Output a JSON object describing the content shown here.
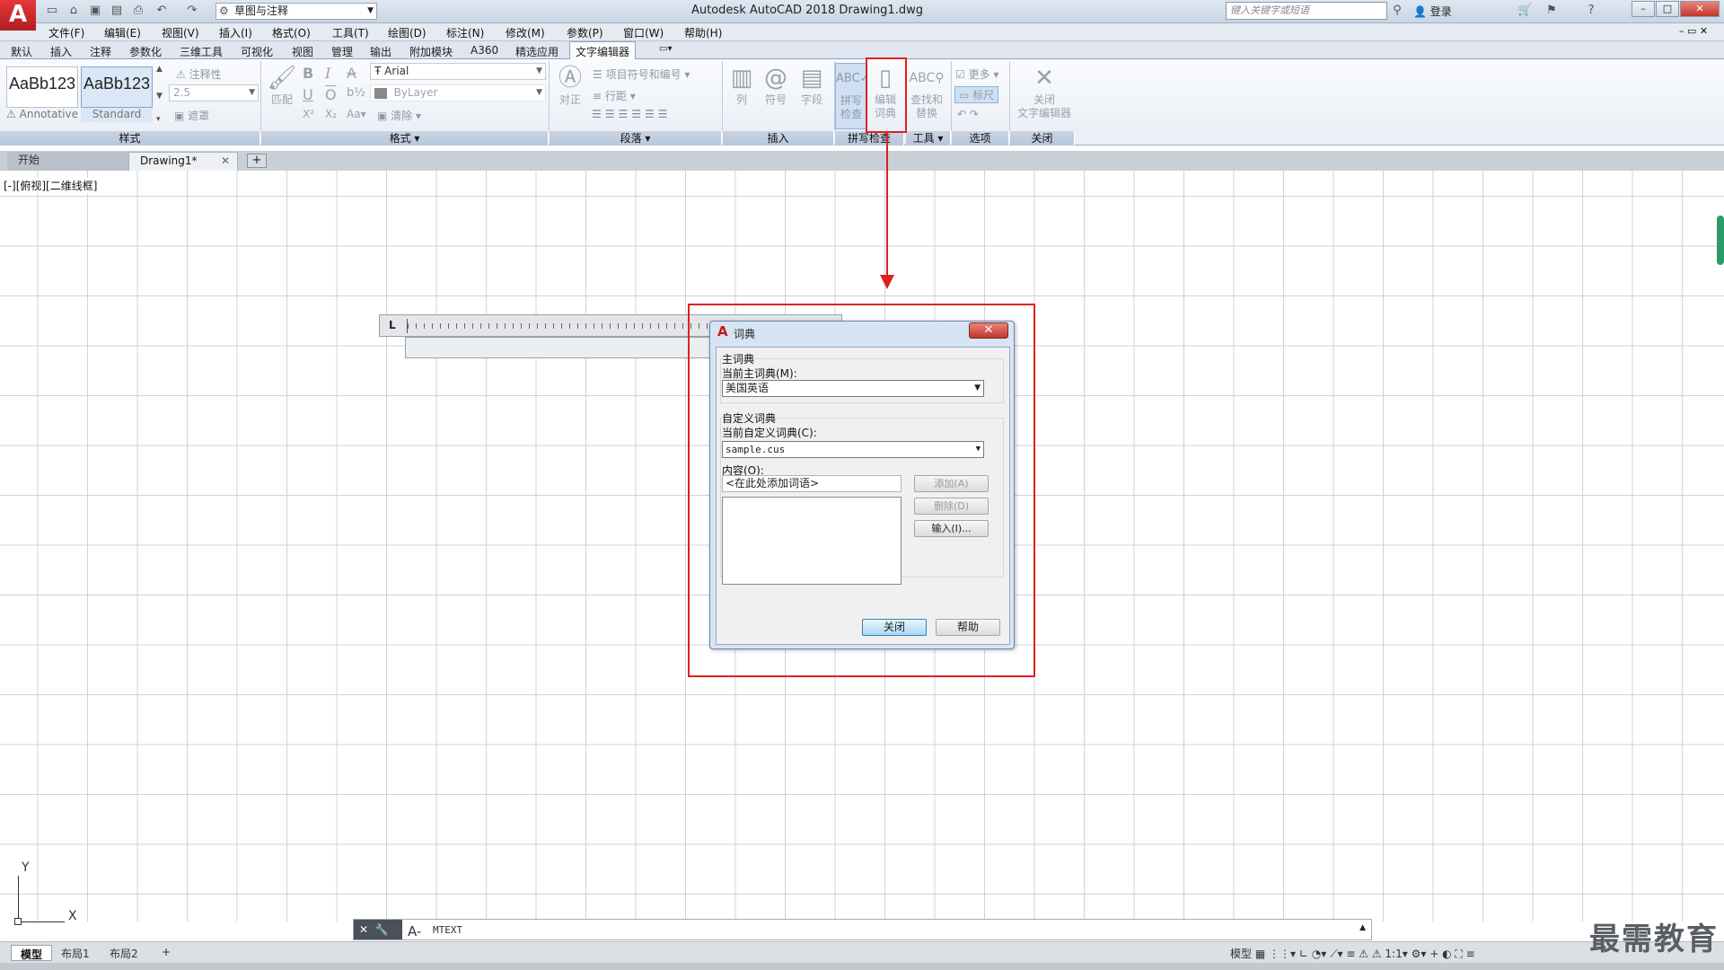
{
  "window": {
    "title": "Autodesk AutoCAD 2018    Drawing1.dwg",
    "workspace": "草图与注释",
    "search_placeholder": "键入关键字或短语",
    "login": "登录",
    "app_logo_letter": "A"
  },
  "menu": [
    "文件(F)",
    "编辑(E)",
    "视图(V)",
    "插入(I)",
    "格式(O)",
    "工具(T)",
    "绘图(D)",
    "标注(N)",
    "修改(M)",
    "参数(P)",
    "窗口(W)",
    "帮助(H)"
  ],
  "ribbon_tabs": [
    "默认",
    "插入",
    "注释",
    "参数化",
    "三维工具",
    "可视化",
    "视图",
    "管理",
    "输出",
    "附加模块",
    "A360",
    "精选应用",
    "文字编辑器"
  ],
  "ribbon_active_tab": "文字编辑器",
  "ribbon": {
    "style": {
      "swatch1": "AaBb123",
      "swatch1_caption": "Annotative",
      "swatch2": "AaBb123",
      "swatch2_caption": "Standard",
      "annotative_label": "注释性",
      "text_height": "2.5",
      "mask_label": "遮罩",
      "panel_title": "样式"
    },
    "format": {
      "match_label": "匹配",
      "font": "Arial",
      "color": "ByLayer",
      "clear_label": "清除",
      "panel_title": "格式"
    },
    "paragraph": {
      "justify_label": "对正",
      "bullets_label": "项目符号和编号",
      "line_spacing_label": "行距",
      "panel_title": "段落"
    },
    "insert": {
      "columns_label": "列",
      "symbol_label": "符号",
      "field_label": "字段",
      "panel_title": "插入"
    },
    "spellcheck": {
      "spell_label_1": "拼写",
      "spell_label_2": "检查",
      "edit_dict_1": "编辑",
      "edit_dict_2": "词典",
      "panel_title": "拼写检查"
    },
    "tools": {
      "find_1": "查找和",
      "find_2": "替换",
      "panel_title": "工具"
    },
    "options": {
      "more_label": "更多",
      "ruler_label": "标尺",
      "panel_title": "选项"
    },
    "close": {
      "close_1": "关闭",
      "close_2": "文字编辑器",
      "panel_title": "关闭"
    }
  },
  "doc_tabs": [
    "开始",
    "Drawing1*"
  ],
  "viewport_label": "[-][俯视][二维线框]",
  "dialog": {
    "title": "词典",
    "main_group": "主词典",
    "main_label": "当前主词典(M):",
    "main_value": "美国英语",
    "custom_group": "自定义词典",
    "custom_label": "当前自定义词典(C):",
    "custom_value": "sample.cus",
    "content_label": "内容(O):",
    "content_value": "<在此处添加词语>",
    "add_button": "添加(A)",
    "delete_button": "删除(D)",
    "import_button": "输入(I)...",
    "close_button": "关闭",
    "help_button": "帮助"
  },
  "command_line": {
    "prompt": "A-",
    "text": "MTEXT"
  },
  "layout_tabs": [
    "模型",
    "布局1",
    "布局2"
  ],
  "status": {
    "model": "模型",
    "scale": "1:1"
  },
  "ucs": {
    "x": "X",
    "y": "Y"
  },
  "watermark": "最需教育",
  "colors": {
    "highlight": "#e0201d",
    "logo": "#c5191b"
  }
}
